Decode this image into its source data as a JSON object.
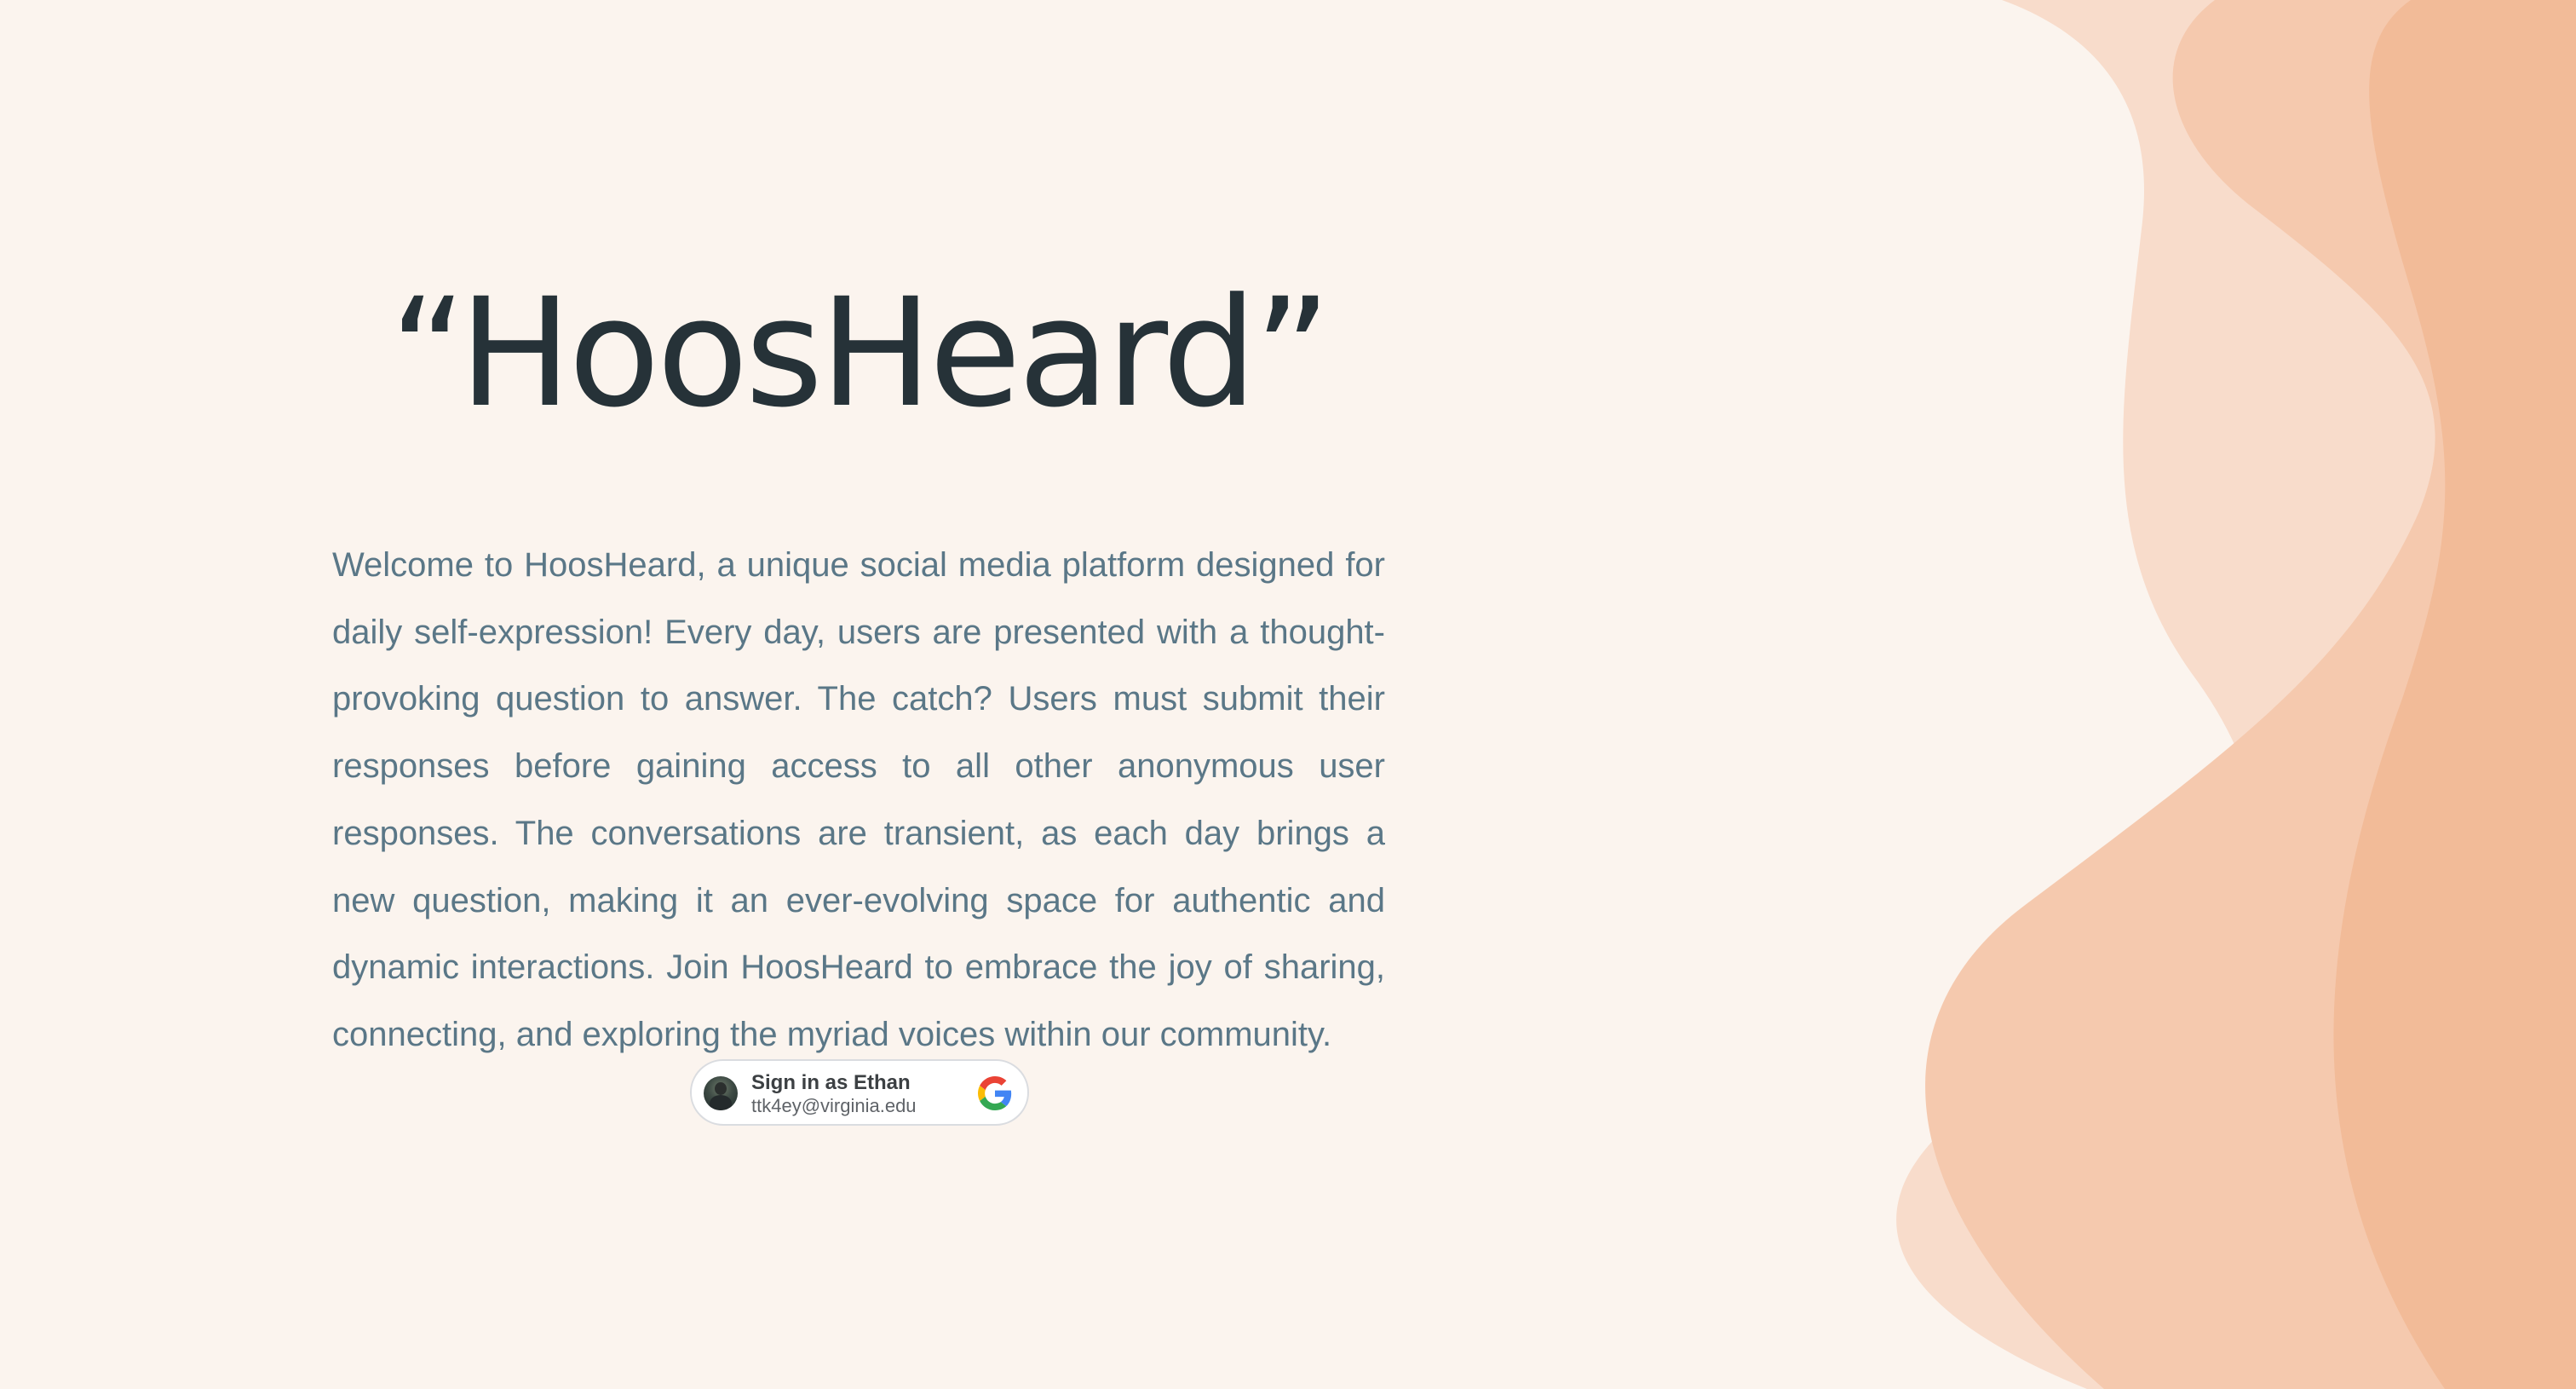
{
  "hero": {
    "title": "“HoosHeard”",
    "description": "Welcome to HoosHeard, a unique social media platform designed for daily self-expression! Every day, users are presented with a thought-provoking question to answer. The catch? Users must submit their responses before gaining access to all other anonymous user responses. The conversations are transient, as each day brings a new question, making it an ever-evolving space for authentic and dynamic interactions. Join HoosHeard to embrace the joy of sharing, connecting, and exploring the myriad voices within our community."
  },
  "signin": {
    "label": "Sign in as Ethan",
    "email": "ttk4ey@virginia.edu",
    "avatar_icon": "user-avatar",
    "provider_icon": "google-icon"
  },
  "colors": {
    "background": "#fbf4ee",
    "wave_light": "#f8dccb",
    "wave_mid": "#f5c9ae",
    "wave_dark": "#f2bb98",
    "title": "#263238",
    "body_text": "#5a7787"
  }
}
